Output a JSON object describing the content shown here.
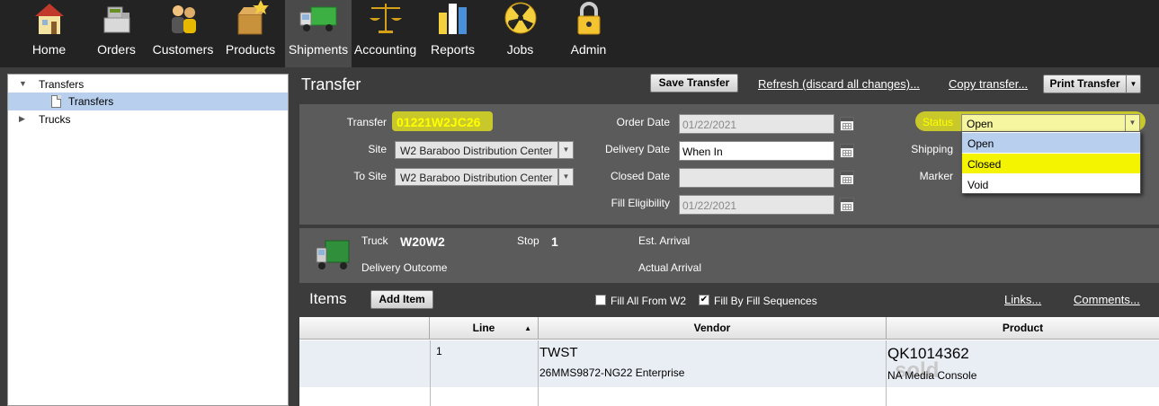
{
  "nav": {
    "items": [
      {
        "label": "Home",
        "icon": "house-icon"
      },
      {
        "label": "Orders",
        "icon": "cash-register-icon"
      },
      {
        "label": "Customers",
        "icon": "people-icon"
      },
      {
        "label": "Products",
        "icon": "boxes-icon"
      },
      {
        "label": "Shipments",
        "icon": "truck-icon"
      },
      {
        "label": "Accounting",
        "icon": "scales-icon"
      },
      {
        "label": "Reports",
        "icon": "bar-chart-icon"
      },
      {
        "label": "Jobs",
        "icon": "radiation-icon"
      },
      {
        "label": "Admin",
        "icon": "padlock-icon"
      }
    ],
    "active": "Shipments"
  },
  "sidebar": {
    "items": [
      {
        "label": "Transfers",
        "expanded": true
      },
      {
        "label": "Transfers",
        "selected": true
      },
      {
        "label": "Trucks",
        "expanded": false
      }
    ]
  },
  "header": {
    "title": "Transfer",
    "save_label": "Save Transfer",
    "refresh_label": "Refresh (discard all changes)...",
    "copy_label": "Copy transfer...",
    "print_label": "Print Transfer"
  },
  "form": {
    "transfer_label": "Transfer",
    "transfer_value": "01221W2JC26",
    "site_label": "Site",
    "site_value": "W2 Baraboo Distribution Center",
    "to_site_label": "To Site",
    "to_site_value": "W2 Baraboo Distribution Center",
    "order_date_label": "Order Date",
    "order_date_value": "01/22/2021",
    "delivery_date_label": "Delivery Date",
    "delivery_date_value": "When In",
    "closed_date_label": "Closed Date",
    "closed_date_value": "",
    "fill_eligibility_label": "Fill Eligibility",
    "fill_eligibility_value": "01/22/2021",
    "status_label": "Status",
    "status_value": "Open",
    "shipping_label": "Shipping",
    "marker_label": "Marker",
    "status_options": [
      "Open",
      "Closed",
      "Void"
    ]
  },
  "truck": {
    "truck_label": "Truck",
    "truck_value": "W20W2",
    "stop_label": "Stop",
    "stop_value": "1",
    "est_arrival_label": "Est. Arrival",
    "delivery_outcome_label": "Delivery Outcome",
    "actual_arrival_label": "Actual Arrival"
  },
  "items": {
    "title": "Items",
    "add_label": "Add Item",
    "fill_all_label": "Fill All From W2",
    "fill_all_checked": false,
    "fill_seq_label": "Fill By Fill Sequences",
    "fill_seq_checked": true,
    "links_label": "Links...",
    "comments_label": "Comments...",
    "columns": [
      "Line",
      "Vendor",
      "Product"
    ],
    "rows": [
      {
        "line": "1",
        "vendor": "TWST",
        "vendor_sub": "26MMS9872-NG22 Enterprise",
        "product": "QK1014362",
        "product_sub": "NA Media Console",
        "watermark": "sold"
      }
    ]
  },
  "colors": {
    "highlight": "#c9c82a",
    "selection": "#b8cfee",
    "dropdown_highlight": "#f4f400",
    "panel": "#5b5b5b"
  }
}
